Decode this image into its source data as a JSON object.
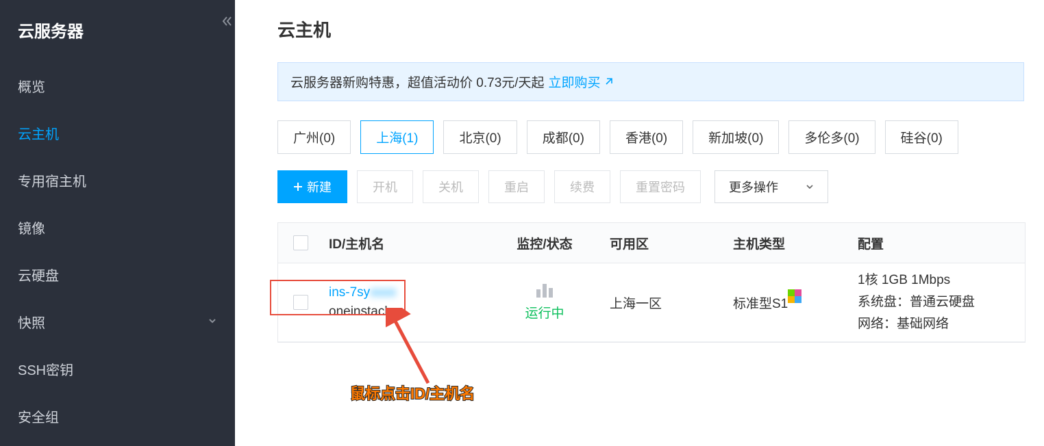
{
  "sidebar": {
    "title": "云服务器",
    "items": [
      {
        "label": "概览"
      },
      {
        "label": "云主机",
        "active": true
      },
      {
        "label": "专用宿主机"
      },
      {
        "label": "镜像"
      },
      {
        "label": "云硬盘"
      },
      {
        "label": "快照",
        "expandable": true
      },
      {
        "label": "SSH密钥"
      },
      {
        "label": "安全组"
      }
    ]
  },
  "page": {
    "title": "云主机"
  },
  "promo": {
    "text": "云服务器新购特惠，超值活动价 0.73元/天起",
    "link_label": "立即购买"
  },
  "regions": [
    {
      "label": "广州(0)"
    },
    {
      "label": "上海(1)",
      "active": true
    },
    {
      "label": "北京(0)"
    },
    {
      "label": "成都(0)"
    },
    {
      "label": "香港(0)"
    },
    {
      "label": "新加坡(0)"
    },
    {
      "label": "多伦多(0)"
    },
    {
      "label": "硅谷(0)"
    }
  ],
  "toolbar": {
    "new_label": "新建",
    "start_label": "开机",
    "stop_label": "关机",
    "restart_label": "重启",
    "renew_label": "续费",
    "resetpwd_label": "重置密码",
    "more_label": "更多操作"
  },
  "table": {
    "headers": {
      "id": "ID/主机名",
      "monitor": "监控/状态",
      "zone": "可用区",
      "type": "主机类型",
      "config": "配置"
    },
    "rows": [
      {
        "id_prefix": "ins-7sy",
        "id_rest": "xxxx",
        "name": "oneinstack",
        "status": "运行中",
        "zone": "上海一区",
        "type": "标准型S1",
        "config_line1": "1核 1GB 1Mbps",
        "config_line2": "系统盘：普通云硬盘",
        "config_line3": "网络：基础网络"
      }
    ]
  },
  "annotation": {
    "text": "鼠标点击ID/主机名"
  }
}
